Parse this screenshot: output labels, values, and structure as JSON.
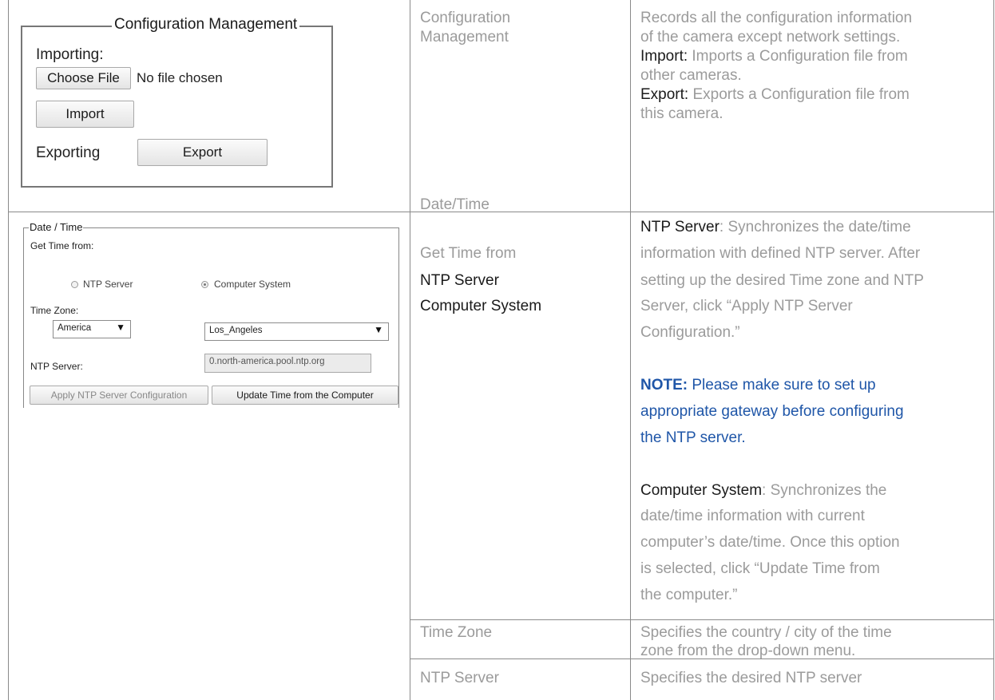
{
  "config_panel": {
    "legend": "Configuration Management",
    "importing_label": "Importing:",
    "choose_file_label": "Choose File",
    "no_file_text": "No file chosen",
    "import_button": "Import",
    "exporting_label": "Exporting",
    "export_button": "Export"
  },
  "row1": {
    "term": [
      "Configuration",
      "Management"
    ],
    "desc_intro_lines": [
      "Records all the configuration information",
      "of the camera except network settings."
    ],
    "import_term": "Import:",
    "import_desc_1": " Imports a Configuration file from",
    "import_desc_2": "other cameras.",
    "export_term": "Export:",
    "export_desc_1": " Exports a Configuration file from",
    "export_desc_2": "this camera."
  },
  "datetime_panel": {
    "legend": "Date / Time",
    "get_time_label": "Get Time from:",
    "radio_ntp": "NTP Server",
    "radio_computer": "Computer System",
    "selected": "Computer System",
    "time_zone_label": "Time Zone:",
    "region_value": "America",
    "city_value": "Los_Angeles",
    "ntp_label": "NTP Server:",
    "ntp_value": "0.north-america.pool.ntp.org",
    "apply_button": "Apply NTP Server Configuration",
    "update_button": "Update Time from the Computer"
  },
  "row2": {
    "term_lines": [
      "Date/Time",
      "Get Time from"
    ],
    "term_dark_lines": [
      "NTP Server",
      "Computer System"
    ],
    "ntp_term": "NTP Server",
    "ntp_desc_first": ": Synchronizes the date/time",
    "ntp_desc_lines": [
      "information with defined NTP server. After",
      "setting up the desired Time zone and NTP",
      "Server, click “Apply NTP Server",
      "Configuration.”"
    ],
    "note_head": "NOTE:",
    "note_first": " Please make sure to set up",
    "note_lines": [
      "appropriate gateway before configuring",
      "the NTP server."
    ],
    "cs_term": "Computer System",
    "cs_desc_first": ": Synchronizes the",
    "cs_desc_lines": [
      "date/time information with current",
      "computer’s date/time. Once this option",
      "is selected, click “Update Time from",
      "the computer.”"
    ]
  },
  "row3": {
    "term": "Time Zone",
    "desc_lines": [
      "Specifies the country / city of the time",
      "zone from the drop-down menu."
    ]
  },
  "row4": {
    "term": "NTP Server",
    "desc_lines": [
      "Specifies the desired NTP server"
    ]
  },
  "colors": {
    "grey_text": "#9b9b9b",
    "dark_text": "#1a1a1a",
    "note_blue": "#1f56a8",
    "grid_line": "#8a8a8a"
  }
}
